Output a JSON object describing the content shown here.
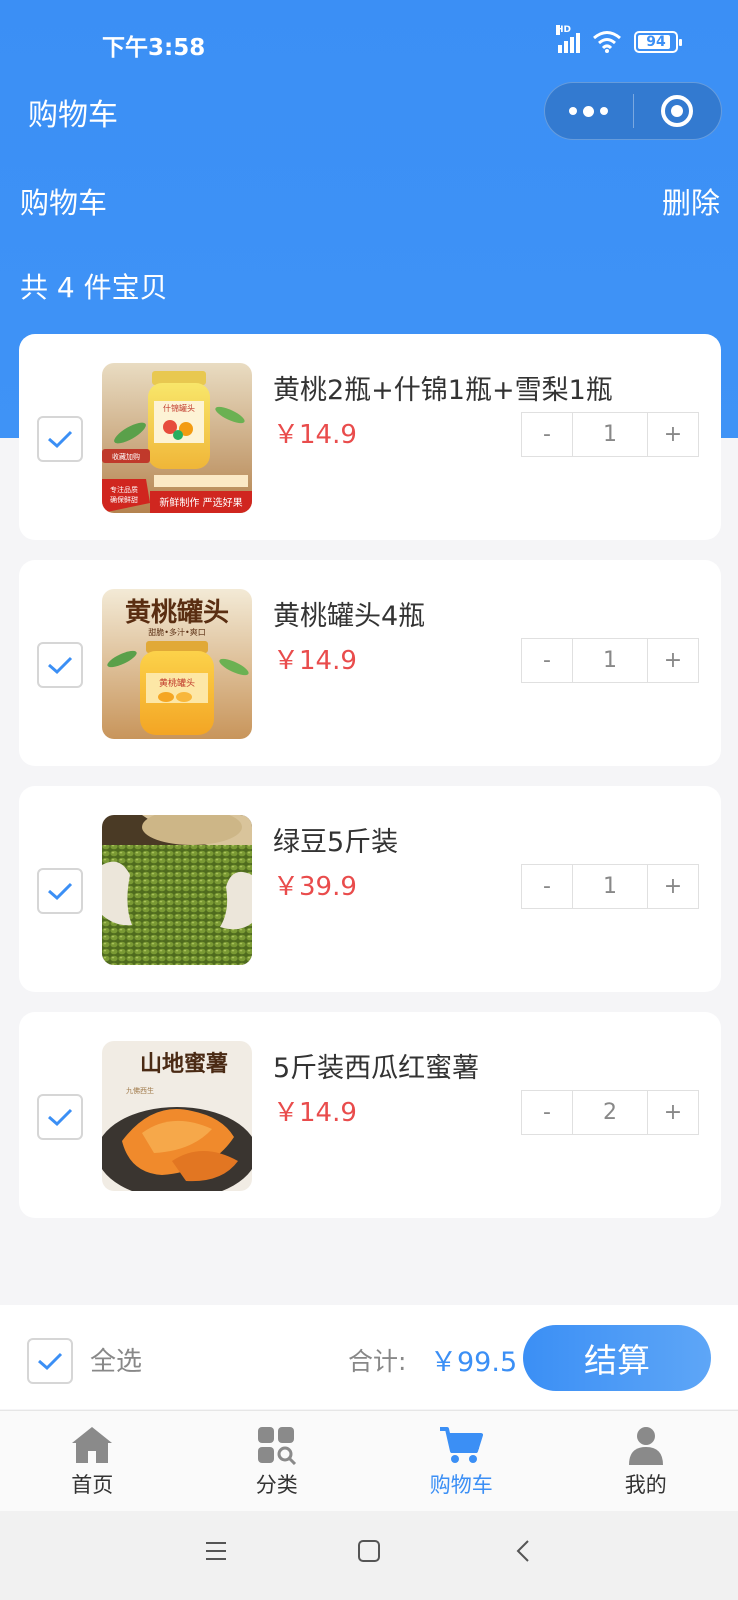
{
  "status_bar": {
    "time": "下午3:58",
    "hd": "HD",
    "battery": "94"
  },
  "nav": {
    "title": "购物车"
  },
  "cart": {
    "title": "购物车",
    "delete_label": "删除",
    "count_text": "共 4 件宝贝",
    "items": [
      {
        "name": "黄桃2瓶+什锦1瓶+雪梨1瓶",
        "price": "￥14.9",
        "quantity": "1",
        "checked": true,
        "image_text": [
          "什锦罐头",
          "收藏加购",
          "专注品质",
          "确保鲜甜",
          "新鲜制作 严选好果"
        ]
      },
      {
        "name": "黄桃罐头4瓶",
        "price": "￥14.9",
        "quantity": "1",
        "checked": true,
        "image_text": [
          "黄桃罐头",
          "甜脆•多汁•爽口",
          "黄桃罐头"
        ]
      },
      {
        "name": "绿豆5斤装",
        "price": "￥39.9",
        "quantity": "1",
        "checked": true,
        "image_text": []
      },
      {
        "name": "5斤装西瓜红蜜薯",
        "price": "￥14.9",
        "quantity": "2",
        "checked": true,
        "image_text": [
          "山地蜜薯",
          "九佛西生"
        ]
      }
    ],
    "minus_label": "-",
    "plus_label": "+"
  },
  "footer": {
    "select_all_label": "全选",
    "total_label": "合计:",
    "total_price": "￥99.5",
    "checkout_label": "结算"
  },
  "tabs": [
    {
      "label": "首页",
      "icon": "home-icon",
      "active": false
    },
    {
      "label": "分类",
      "icon": "category-icon",
      "active": false
    },
    {
      "label": "购物车",
      "icon": "cart-icon",
      "active": true
    },
    {
      "label": "我的",
      "icon": "user-icon",
      "active": false
    }
  ],
  "colors": {
    "primary": "#3b8ff5",
    "price": "#e94c4c",
    "background": "#f5f5f7"
  }
}
